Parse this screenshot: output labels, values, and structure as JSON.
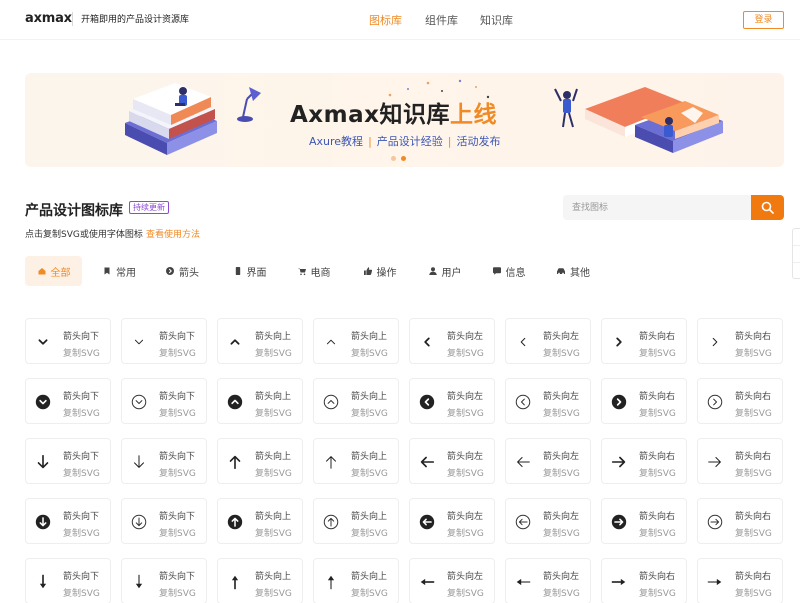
{
  "header": {
    "logo": "axmax",
    "tagline": "开箱即用的产品设计资源库",
    "nav": [
      "图标库",
      "组件库",
      "知识库"
    ],
    "active_nav": 0,
    "login": "登录"
  },
  "banner": {
    "title_main": "Axmax知识库",
    "title_highlight": "上线",
    "sub": [
      "Axure教程",
      "产品设计经验",
      "活动发布"
    ],
    "sub_separator": "|",
    "carousel_pages": 2,
    "carousel_active": 1
  },
  "section": {
    "title": "产品设计图标库",
    "badge": "持续更新",
    "hint": "点击复制SVG或使用字体图标",
    "hint_link": "查看使用方法"
  },
  "search": {
    "placeholder": "查找图标",
    "icon": "search-icon"
  },
  "tabs": [
    {
      "label": "全部",
      "icon": "home-icon"
    },
    {
      "label": "常用",
      "icon": "bookmark-icon"
    },
    {
      "label": "箭头",
      "icon": "arrow-circle-icon"
    },
    {
      "label": "界面",
      "icon": "phone-icon"
    },
    {
      "label": "电商",
      "icon": "cart-icon"
    },
    {
      "label": "操作",
      "icon": "thumb-up-icon"
    },
    {
      "label": "用户",
      "icon": "user-icon"
    },
    {
      "label": "信息",
      "icon": "message-icon"
    },
    {
      "label": "其他",
      "icon": "car-icon"
    }
  ],
  "active_tab": 0,
  "copy_label": "复制SVG",
  "icon_rows": [
    [
      {
        "name": "箭头向下",
        "icon": "chevron-down-icon"
      },
      {
        "name": "箭头向下",
        "icon": "chevron-down-thin-icon"
      },
      {
        "name": "箭头向上",
        "icon": "chevron-up-icon"
      },
      {
        "name": "箭头向上",
        "icon": "chevron-up-thin-icon"
      },
      {
        "name": "箭头向左",
        "icon": "chevron-left-icon"
      },
      {
        "name": "箭头向左",
        "icon": "chevron-left-thin-icon"
      },
      {
        "name": "箭头向右",
        "icon": "chevron-right-icon"
      },
      {
        "name": "箭头向右",
        "icon": "chevron-right-thin-icon"
      }
    ],
    [
      {
        "name": "箭头向下",
        "icon": "chevron-down-circle-filled-icon"
      },
      {
        "name": "箭头向下",
        "icon": "chevron-down-circle-icon"
      },
      {
        "name": "箭头向上",
        "icon": "chevron-up-circle-filled-icon"
      },
      {
        "name": "箭头向上",
        "icon": "chevron-up-circle-icon"
      },
      {
        "name": "箭头向左",
        "icon": "chevron-left-circle-filled-icon"
      },
      {
        "name": "箭头向左",
        "icon": "chevron-left-circle-icon"
      },
      {
        "name": "箭头向右",
        "icon": "chevron-right-circle-filled-icon"
      },
      {
        "name": "箭头向右",
        "icon": "chevron-right-circle-icon"
      }
    ],
    [
      {
        "name": "箭头向下",
        "icon": "arrow-down-icon"
      },
      {
        "name": "箭头向下",
        "icon": "arrow-down-thin-icon"
      },
      {
        "name": "箭头向上",
        "icon": "arrow-up-icon"
      },
      {
        "name": "箭头向上",
        "icon": "arrow-up-thin-icon"
      },
      {
        "name": "箭头向左",
        "icon": "arrow-left-icon"
      },
      {
        "name": "箭头向左",
        "icon": "arrow-left-thin-icon"
      },
      {
        "name": "箭头向右",
        "icon": "arrow-right-icon"
      },
      {
        "name": "箭头向右",
        "icon": "arrow-right-thin-icon"
      }
    ],
    [
      {
        "name": "箭头向下",
        "icon": "arrow-down-circle-filled-icon"
      },
      {
        "name": "箭头向下",
        "icon": "arrow-down-circle-icon"
      },
      {
        "name": "箭头向上",
        "icon": "arrow-up-circle-filled-icon"
      },
      {
        "name": "箭头向上",
        "icon": "arrow-up-circle-icon"
      },
      {
        "name": "箭头向左",
        "icon": "arrow-left-circle-filled-icon"
      },
      {
        "name": "箭头向左",
        "icon": "arrow-left-circle-icon"
      },
      {
        "name": "箭头向右",
        "icon": "arrow-right-circle-filled-icon"
      },
      {
        "name": "箭头向右",
        "icon": "arrow-right-circle-icon"
      }
    ],
    [
      {
        "name": "箭头向下",
        "icon": "arrow-down-bold-icon"
      },
      {
        "name": "箭头向下",
        "icon": "arrow-down-light-icon"
      },
      {
        "name": "箭头向上",
        "icon": "arrow-up-bold-icon"
      },
      {
        "name": "箭头向上",
        "icon": "arrow-up-light-icon"
      },
      {
        "name": "箭头向左",
        "icon": "arrow-left-bold-icon"
      },
      {
        "name": "箭头向左",
        "icon": "arrow-left-light-icon"
      },
      {
        "name": "箭头向右",
        "icon": "arrow-right-bold-icon"
      },
      {
        "name": "箭头向右",
        "icon": "arrow-right-light-icon"
      }
    ]
  ],
  "colors": {
    "accent": "#f08a24",
    "search_button": "#f07a10",
    "badge": "#8e4bd2",
    "banner_sub": "#3b57b5"
  }
}
